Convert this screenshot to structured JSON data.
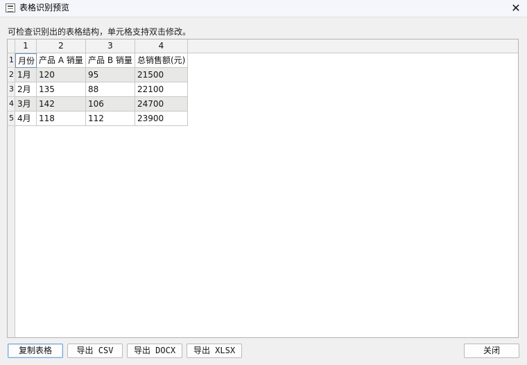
{
  "window": {
    "title": "表格识别预览",
    "close_icon": "close-icon",
    "app_icon": "table-window-icon"
  },
  "hint": "可检查识别出的表格结构，单元格支持双击修改。",
  "table": {
    "column_headers": [
      "1",
      "2",
      "3",
      "4"
    ],
    "row_headers": [
      "1",
      "2",
      "3",
      "4",
      "5"
    ],
    "rows": [
      [
        "月份",
        "产品 A 销量",
        "产品 B 销量",
        "总销售额(元)"
      ],
      [
        "1月",
        "120",
        "95",
        "21500"
      ],
      [
        "2月",
        "135",
        "88",
        "22100"
      ],
      [
        "3月",
        "142",
        "106",
        "24700"
      ],
      [
        "4月",
        "118",
        "112",
        "23900"
      ]
    ]
  },
  "buttons": {
    "copy": "复制表格",
    "export_csv": "导出 CSV",
    "export_docx": "导出 DOCX",
    "export_xlsx": "导出 XLSX",
    "close": "关闭"
  },
  "colors": {
    "shaded_row": "#e8e8e6",
    "primary_button_border": "#7aa6d9"
  }
}
